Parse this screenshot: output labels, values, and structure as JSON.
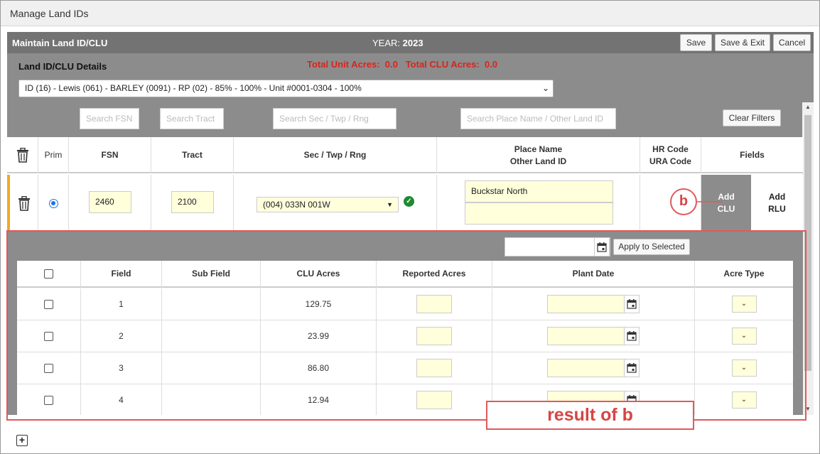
{
  "window": {
    "title": "Manage Land IDs"
  },
  "header": {
    "title": "Maintain Land ID/CLU",
    "year_label": "YEAR:",
    "year_value": "2023",
    "save": "Save",
    "save_exit": "Save & Exit",
    "cancel": "Cancel"
  },
  "details": {
    "label": "Land ID/CLU Details",
    "totals": "Total Unit Acres:  0.0   Total CLU Acres:  0.0",
    "land_id_selected": "ID (16) - Lewis (061) - BARLEY (0091) - RP (02) - 85% - 100% - Unit #0001-0304 - 100%"
  },
  "filters": {
    "fsn": "Search FSN",
    "tract": "Search Tract",
    "sec": "Search Sec / Twp / Rng",
    "place": "Search Place Name / Other Land ID",
    "clear": "Clear Filters"
  },
  "columns": {
    "prim": "Prim",
    "fsn": "FSN",
    "tract": "Tract",
    "sec": "Sec / Twp / Rng",
    "place1": "Place Name",
    "place2": "Other Land ID",
    "hr1": "HR Code",
    "hr2": "URA Code",
    "fields": "Fields"
  },
  "row": {
    "fsn": "2460",
    "tract": "2100",
    "sec": "(004) 033N 001W",
    "place_name": "Buckstar North",
    "other_land_id": "",
    "add_clu_1": "Add",
    "add_clu_2": "CLU",
    "add_rlu_1": "Add",
    "add_rlu_2": "RLU"
  },
  "apply": {
    "label": "Apply to Selected",
    "date_value": ""
  },
  "subtable": {
    "headers": {
      "field": "Field",
      "subfield": "Sub Field",
      "clu": "CLU Acres",
      "reported": "Reported Acres",
      "plant": "Plant Date",
      "acre_type": "Acre Type"
    },
    "rows": [
      {
        "field": "1",
        "subfield": "",
        "clu": "129.75"
      },
      {
        "field": "2",
        "subfield": "",
        "clu": "23.99"
      },
      {
        "field": "3",
        "subfield": "",
        "clu": "86.80"
      },
      {
        "field": "4",
        "subfield": "",
        "clu": "12.94"
      }
    ]
  },
  "annotations": {
    "b": "b",
    "result": "result of b"
  },
  "colors": {
    "header_bg": "#737373",
    "panel_bg": "#8c8c8c",
    "totals_red": "#d9241c",
    "input_yellow": "#ffffdc",
    "annotation_red": "#e05a5a",
    "active_row_accent": "#f5a623",
    "check_green": "#1e8a2e",
    "radio_blue": "#1a73e8"
  },
  "icons": [
    "trash-icon",
    "check-circle-icon",
    "calendar-icon",
    "chevron-down-icon",
    "plus-square-icon"
  ]
}
